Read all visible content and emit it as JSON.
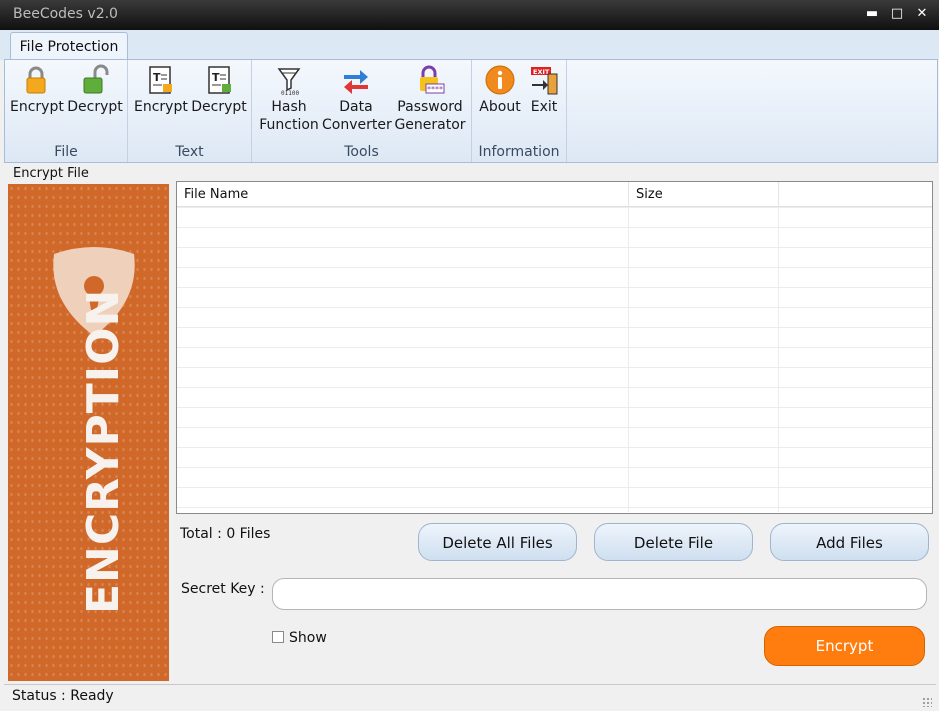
{
  "window": {
    "title": "BeeCodes v2.0"
  },
  "ribbon": {
    "tab": "File Protection",
    "groups": [
      {
        "label": "File",
        "buttons": [
          {
            "label": "Encrypt",
            "icon": "lock-closed-icon"
          },
          {
            "label": "Decrypt",
            "icon": "lock-open-icon"
          }
        ]
      },
      {
        "label": "Text",
        "buttons": [
          {
            "label": "Encrypt",
            "icon": "text-lock-icon"
          },
          {
            "label": "Decrypt",
            "icon": "text-unlock-icon"
          }
        ]
      },
      {
        "label": "Tools",
        "buttons": [
          {
            "label1": "Hash",
            "label2": "Function",
            "icon": "hash-funnel-icon"
          },
          {
            "label1": "Data",
            "label2": "Converter",
            "icon": "convert-arrows-icon"
          },
          {
            "label1": "Password",
            "label2": "Generator",
            "icon": "password-lock-icon"
          }
        ]
      },
      {
        "label": "Information",
        "buttons": [
          {
            "label": "About",
            "icon": "info-icon"
          },
          {
            "label": "Exit",
            "icon": "exit-door-icon"
          }
        ]
      }
    ]
  },
  "main": {
    "section_title": "Encrypt File",
    "sidebar_word": "ENCRYPTION",
    "table": {
      "columns": [
        "File Name",
        "Size"
      ],
      "rows": []
    },
    "total_label": "Total : 0 Files",
    "buttons": {
      "delete_all": "Delete All Files",
      "delete": "Delete File",
      "add": "Add Files"
    },
    "secret_label": "Secret Key :",
    "secret_value": "",
    "show_label": "Show",
    "show_checked": false,
    "encrypt_label": "Encrypt"
  },
  "status": {
    "text": "Status : Ready"
  },
  "colors": {
    "accent": "#ff7d0e",
    "banner": "#d0682a",
    "ribbon": "#dde8f5"
  }
}
